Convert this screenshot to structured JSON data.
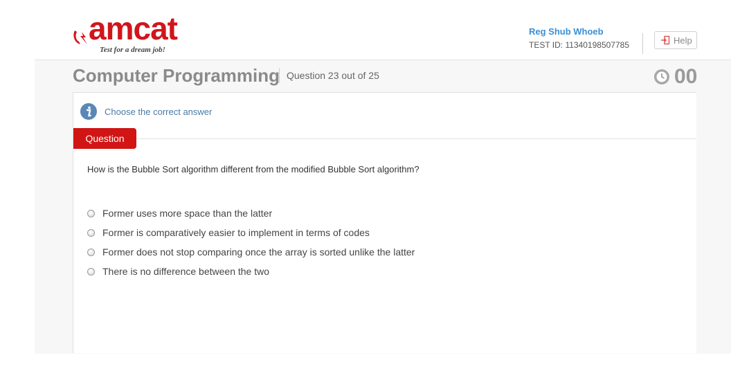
{
  "header": {
    "logo_text": "amcat",
    "logo_tagline": "Test for a dream job!",
    "user_name": "Reg Shub Whoeb",
    "test_id": "TEST ID: 11340198507785",
    "help_label": "Help"
  },
  "section": {
    "title": "Computer Programming",
    "question_count": "Question 23 out of 25",
    "timer": "00"
  },
  "instruction": "Choose the correct answer",
  "question": {
    "tab_label": "Question",
    "text": "How is the Bubble Sort algorithm different from the modified Bubble Sort algorithm?",
    "options": [
      "Former uses more space than the latter",
      "Former is comparatively easier to implement in terms of codes",
      "Former does not stop comparing once the array is sorted unlike the latter",
      "There is no difference between the two"
    ]
  },
  "colors": {
    "brand_red": "#d11414",
    "link_blue": "#3a8fd6",
    "info_blue": "#4a7aa4"
  },
  "icons": {
    "logo": "amcat-logo-icon",
    "help": "sign-in-icon",
    "timer": "clock-icon",
    "info": "info-icon"
  }
}
